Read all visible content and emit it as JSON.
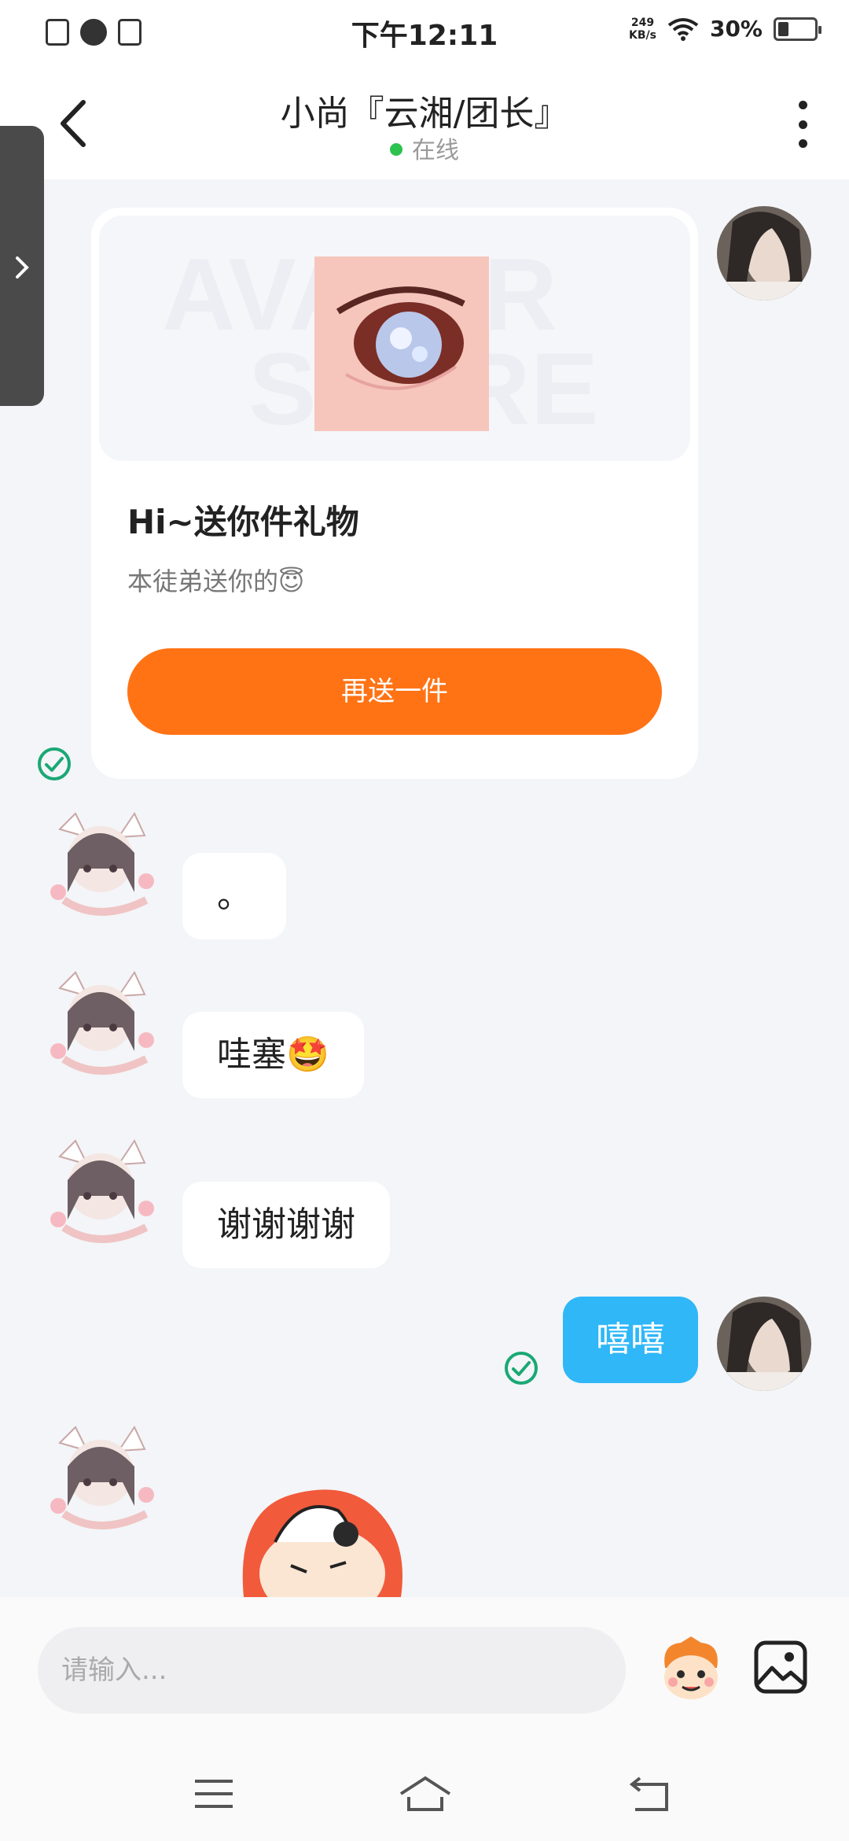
{
  "status_bar": {
    "time": "下午12:11",
    "net_speed_value": "249",
    "net_speed_unit": "KB/s",
    "battery": "30%",
    "battery_level": 0.3
  },
  "header": {
    "title": "小尚『云湘/团长』",
    "status": "在线"
  },
  "gift_card": {
    "watermark_line1": "AVATAR",
    "watermark_line2": "STORE",
    "title": "Hi~送你件礼物",
    "subtitle": "本徒弟送你的😇",
    "button_label": "再送一件"
  },
  "messages": [
    {
      "from": "other",
      "text": "。"
    },
    {
      "from": "other",
      "text": "哇塞🤩"
    },
    {
      "from": "other",
      "text": "谢谢谢谢"
    },
    {
      "from": "me",
      "text": "嘻嘻"
    }
  ],
  "input": {
    "placeholder": "请输入..."
  },
  "colors": {
    "accent_orange": "#ff7315",
    "my_bubble": "#2fb7f8",
    "online_dot": "#2cc24d",
    "check_green": "#1aa874"
  }
}
